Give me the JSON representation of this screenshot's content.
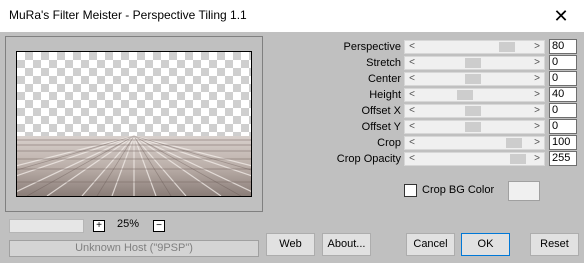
{
  "window": {
    "title": "MuRa's Filter Meister - Perspective Tiling 1.1",
    "close_glyph": "✕"
  },
  "preview": {
    "zoom_minus": "−",
    "zoom_plus": "+",
    "zoom_level": "25%",
    "host_status": "Unknown Host (\"9PSP\")"
  },
  "params": [
    {
      "label": "Perspective",
      "value": "80"
    },
    {
      "label": "Stretch",
      "value": "0"
    },
    {
      "label": "Center",
      "value": "0"
    },
    {
      "label": "Height",
      "value": "40"
    },
    {
      "label": "Offset X",
      "value": "0"
    },
    {
      "label": "Offset Y",
      "value": "0"
    },
    {
      "label": "Crop",
      "value": "100"
    },
    {
      "label": "Crop Opacity",
      "value": "255"
    }
  ],
  "crop_bg": {
    "label": "Crop BG Color",
    "checked": false,
    "swatch_color": "#f0f0f0"
  },
  "buttons": {
    "web": "Web",
    "about": "About...",
    "cancel": "Cancel",
    "ok": "OK",
    "reset": "Reset"
  },
  "colors": {
    "dialog_bg": "#c0c0c0",
    "focus_border": "#0078d7"
  }
}
